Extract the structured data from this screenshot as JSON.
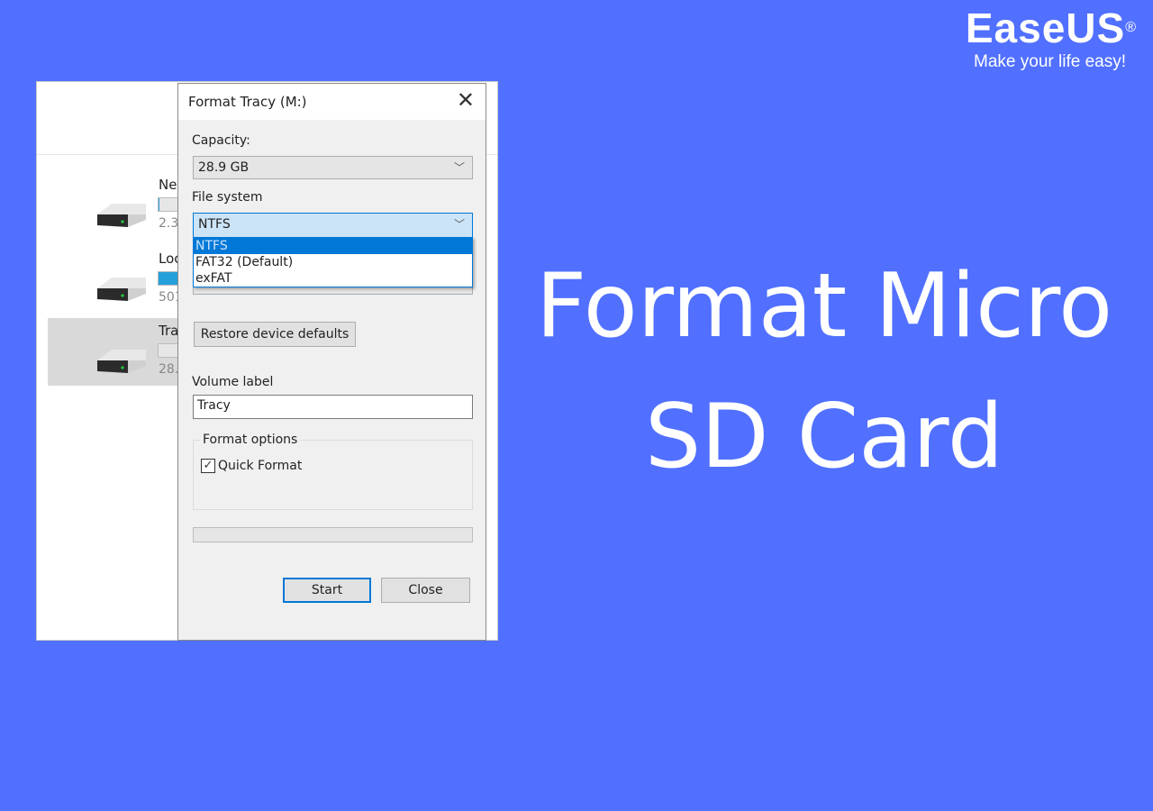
{
  "brand": {
    "logo": "EaseUS",
    "registered": "®",
    "tagline": "Make your life easy!"
  },
  "headline": {
    "line1": "Format Micro",
    "line2": "SD Card"
  },
  "explorer": {
    "drives": [
      {
        "name_visible": "Ne",
        "size_visible": "2.3",
        "usage": 0.05,
        "selected": false
      },
      {
        "name_visible": "Loc",
        "size_visible": "501",
        "usage": 0.9,
        "selected": false
      },
      {
        "name_visible": "Tra",
        "size_visible": "28.",
        "usage": 0.0,
        "selected": true
      }
    ]
  },
  "dialog": {
    "title": "Format Tracy (M:)",
    "capacity_label": "Capacity:",
    "capacity_value": "28.9 GB",
    "filesystem_label": "File system",
    "filesystem_value": "NTFS",
    "filesystem_options": [
      "NTFS",
      "FAT32 (Default)",
      "exFAT"
    ],
    "restore_button": "Restore device defaults",
    "volume_label": "Volume label",
    "volume_value": "Tracy",
    "format_options_label": "Format options",
    "quick_format_label": "Quick Format",
    "quick_format_checked": true,
    "progress": 0,
    "start_button": "Start",
    "close_button": "Close"
  },
  "colors": {
    "background": "#5170ff",
    "accent": "#0078d7"
  }
}
